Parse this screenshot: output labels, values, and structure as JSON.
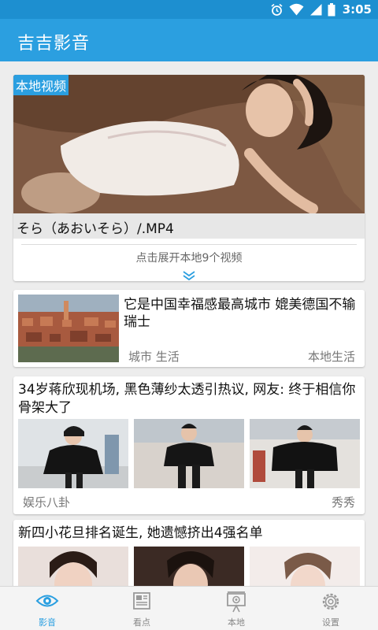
{
  "status_bar": {
    "time": "3:05"
  },
  "app": {
    "title": "吉吉影音"
  },
  "local_video": {
    "tag": "本地视频",
    "filename": "そら（あおいそら）/.MP4",
    "expand_text": "点击展开本地9个视频"
  },
  "news": [
    {
      "title": "它是中国幸福感最高城市 媲美德国不输瑞士",
      "category": "城市 生活",
      "source": "本地生活"
    },
    {
      "title": "34岁蒋欣现机场, 黑色薄纱太透引热议, 网友: 终于相信你骨架大了",
      "category": "娱乐八卦",
      "source": "秀秀"
    },
    {
      "title": "新四小花旦排名诞生, 她遗憾挤出4强名单"
    }
  ],
  "bottom_nav": {
    "items": [
      {
        "label": "影音",
        "active": true
      },
      {
        "label": "看点",
        "active": false
      },
      {
        "label": "本地",
        "active": false
      },
      {
        "label": "设置",
        "active": false
      }
    ]
  },
  "colors": {
    "accent": "#2b9fe0",
    "statusbar": "#1d8fd0",
    "background": "#ededed"
  }
}
